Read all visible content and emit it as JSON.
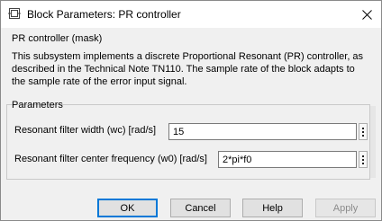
{
  "window": {
    "title": "Block Parameters: PR controller"
  },
  "mask": {
    "group_title": "PR controller (mask)",
    "description_lines": [
      "This subsystem implements a discrete Proportional Resonant (PR) controller, as",
      "described in the Technical Note TN110. The sample rate of the block adapts to",
      "the sample rate of the error input signal."
    ]
  },
  "parameters": {
    "group_title": "Parameters",
    "items": [
      {
        "label": "Resonant filter width (wc) [rad/s]",
        "value": "15"
      },
      {
        "label": "Resonant filter center frequency (w0) [rad/s]",
        "value": "2*pi*f0"
      }
    ]
  },
  "buttons": {
    "ok": "OK",
    "cancel": "Cancel",
    "help": "Help",
    "apply": "Apply"
  },
  "icons": {
    "app": "simulink-block-icon",
    "close": "close-icon",
    "menu": "vertical-ellipsis-icon"
  },
  "colors": {
    "default_button_border": "#0078d7",
    "dialog_background": "#f0f0f0"
  }
}
